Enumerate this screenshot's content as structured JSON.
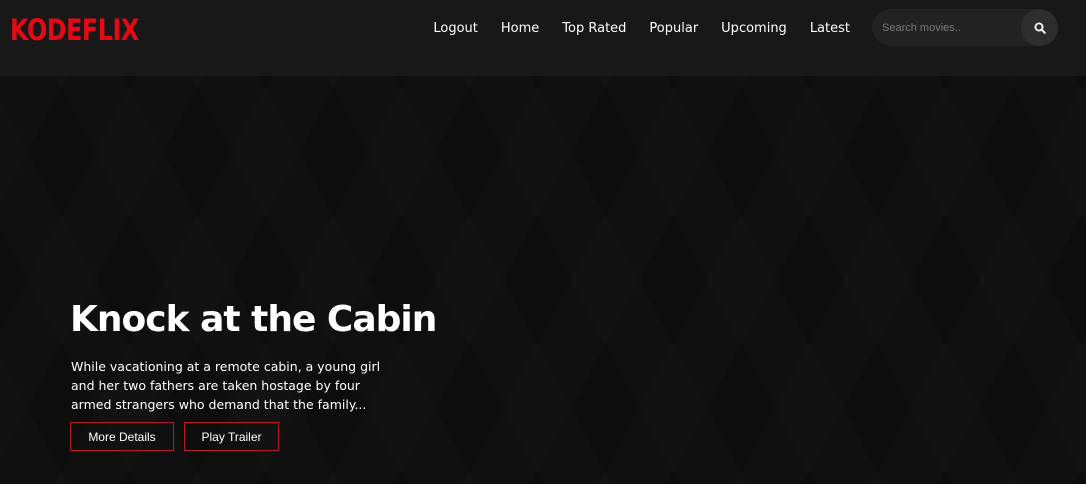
{
  "brand": {
    "logo": "KODEFLIX",
    "accent_color": "#e50914"
  },
  "nav": {
    "items": [
      {
        "label": "Logout"
      },
      {
        "label": "Home"
      },
      {
        "label": "Top Rated"
      },
      {
        "label": "Popular"
      },
      {
        "label": "Upcoming"
      },
      {
        "label": "Latest"
      }
    ]
  },
  "search": {
    "placeholder": "Search movies..",
    "value": "",
    "icon": "search-icon"
  },
  "hero": {
    "title": "Knock at the Cabin",
    "description": "While vacationing at a remote cabin, a young girl and her two fathers are taken hostage by four armed strangers who demand that the family...",
    "buttons": {
      "details_label": "More Details",
      "trailer_label": "Play Trailer"
    }
  }
}
